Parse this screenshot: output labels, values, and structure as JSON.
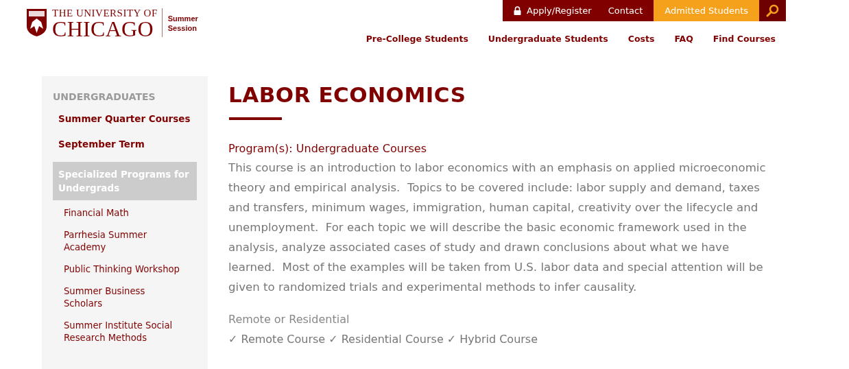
{
  "logo": {
    "line_1": "THE UNIVERSITY OF",
    "line_2": "CHICAGO",
    "session": "Summer Session"
  },
  "utility_nav": [
    {
      "kind": "lock-link",
      "label": "Apply/Register"
    },
    {
      "kind": "link",
      "label": "Contact"
    },
    {
      "kind": "highlight",
      "label": "Admitted Students"
    },
    {
      "kind": "search"
    }
  ],
  "main_nav": [
    "Pre-College Students",
    "Undergraduate Students",
    "Costs",
    "FAQ",
    "Find Courses"
  ],
  "sidebar": {
    "heading": "UNDERGRADUATES",
    "items": [
      {
        "label": "Summer Quarter Courses",
        "selected": false
      },
      {
        "label": "September Term",
        "selected": false
      },
      {
        "label": "Specialized Programs for Undergrads",
        "selected": true,
        "children": [
          {
            "label": "Financial Math",
            "selected": false
          },
          {
            "label": "Parrhesia Summer Academy",
            "selected": false
          },
          {
            "label": "Public Thinking Workshop",
            "selected": false
          },
          {
            "label": "Summer Business Scholars",
            "selected": false
          },
          {
            "label": "Summer Institute Social Research Methods",
            "selected": false
          }
        ]
      }
    ]
  },
  "course": {
    "title": "LABOR ECONOMICS",
    "program": "Program(s): Undergraduate Courses",
    "description": "This course is an introduction to labor economics with an emphasis on applied microeconomic theory and empirical analysis.  Topics to be covered include: labor supply and demand, taxes and transfers, minimum wages, immigration, human capital, creativity over the lifecycle and unemployment.  For each topic we will describe the basic economic framework used in the analysis, analyze associated cases of study and drawn conclusions about what we have learned.  Most of the examples will be taken from U.S. labor data and special attention will be given to randomized trials and experimental methods to infer causality.",
    "format_label": "Remote or Residential",
    "formats": [
      "✓ Remote Course",
      "✓ Residential Course",
      "✓ Hybrid Course"
    ]
  }
}
